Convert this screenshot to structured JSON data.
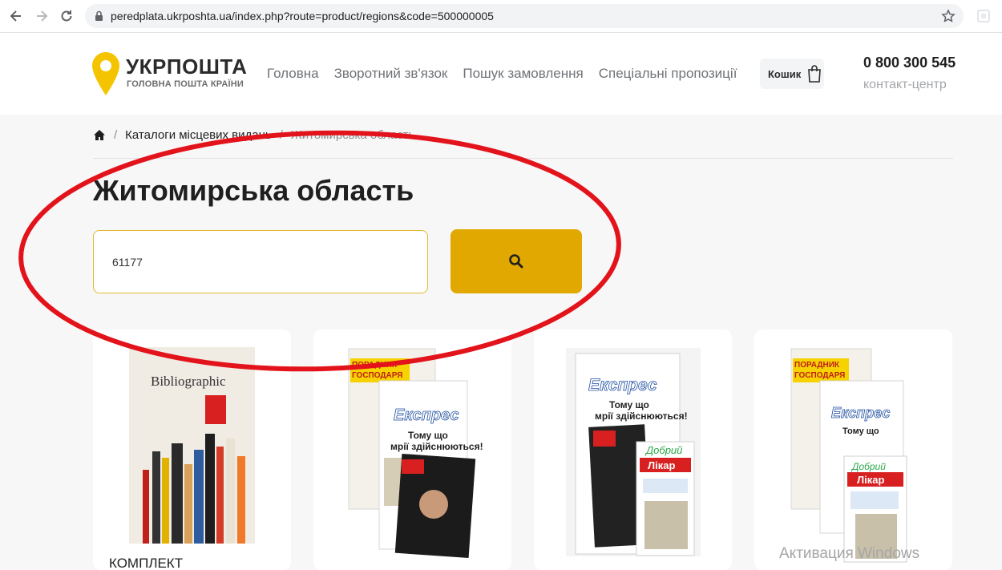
{
  "browser": {
    "url": "peredplata.ukrposhta.ua/index.php?route=product/regions&code=500000005"
  },
  "header": {
    "brand": "УКРПОШТА",
    "tagline": "ГОЛОВНА ПОШТА КРАЇНИ",
    "menu": [
      "Головна",
      "Зворотний зв'язок",
      "Пошук замовлення",
      "Спеціальні пропозиції"
    ],
    "cart_label": "Кошик",
    "phone": "0 800 300 545",
    "contact_label": "контакт-центр"
  },
  "breadcrumb": {
    "items": [
      "Каталоги місцевих видань",
      "Житомирська область"
    ],
    "separator": "/"
  },
  "page": {
    "title": "Житомирська область"
  },
  "search": {
    "value": "61177"
  },
  "cards": [
    {
      "caption": "КОМПЛЕКТ"
    },
    {
      "caption": ""
    },
    {
      "caption": ""
    },
    {
      "caption": ""
    }
  ],
  "cover_texts": {
    "book_title": "Bibliographic",
    "poradnyk": "ПОРАДНИК",
    "hospodarya": "ГОСПОДАРЯ",
    "ekspres": "Експрес",
    "headline": "Тому що мрії здійснюються!",
    "likar": "Лікар",
    "dobryi": "Добрий"
  },
  "overlay": {
    "watermark": "Активация Windows"
  },
  "colors": {
    "accent": "#e0a800",
    "input_border": "#e2b830",
    "annotation_red": "#e3131b"
  }
}
